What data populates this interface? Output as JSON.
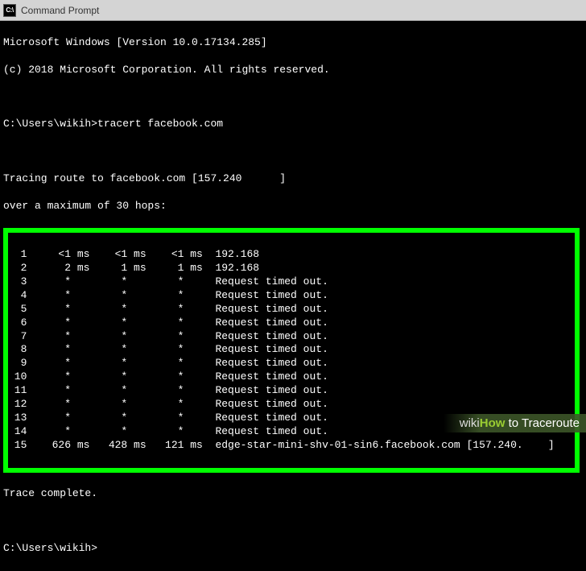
{
  "titlebar": {
    "icon_text": "C:\\",
    "title": "Command Prompt"
  },
  "header": {
    "line1": "Microsoft Windows [Version 10.0.17134.285]",
    "line2": "(c) 2018 Microsoft Corporation. All rights reserved."
  },
  "prompt1": "C:\\Users\\wikih>tracert facebook.com",
  "tracing": {
    "line1": "Tracing route to facebook.com [157.240      ]",
    "line2": "over a maximum of 30 hops:"
  },
  "hops": [
    {
      "n": " 1",
      "t1": "   <1 ms",
      "t2": "   <1 ms",
      "t3": "   <1 ms",
      "dest": "192.168"
    },
    {
      "n": " 2",
      "t1": "    2 ms",
      "t2": "    1 ms",
      "t3": "    1 ms",
      "dest": "192.168"
    },
    {
      "n": " 3",
      "t1": "    *   ",
      "t2": "    *   ",
      "t3": "    *   ",
      "dest": "Request timed out."
    },
    {
      "n": " 4",
      "t1": "    *   ",
      "t2": "    *   ",
      "t3": "    *   ",
      "dest": "Request timed out."
    },
    {
      "n": " 5",
      "t1": "    *   ",
      "t2": "    *   ",
      "t3": "    *   ",
      "dest": "Request timed out."
    },
    {
      "n": " 6",
      "t1": "    *   ",
      "t2": "    *   ",
      "t3": "    *   ",
      "dest": "Request timed out."
    },
    {
      "n": " 7",
      "t1": "    *   ",
      "t2": "    *   ",
      "t3": "    *   ",
      "dest": "Request timed out."
    },
    {
      "n": " 8",
      "t1": "    *   ",
      "t2": "    *   ",
      "t3": "    *   ",
      "dest": "Request timed out."
    },
    {
      "n": " 9",
      "t1": "    *   ",
      "t2": "    *   ",
      "t3": "    *   ",
      "dest": "Request timed out."
    },
    {
      "n": "10",
      "t1": "    *   ",
      "t2": "    *   ",
      "t3": "    *   ",
      "dest": "Request timed out."
    },
    {
      "n": "11",
      "t1": "    *   ",
      "t2": "    *   ",
      "t3": "    *   ",
      "dest": "Request timed out."
    },
    {
      "n": "12",
      "t1": "    *   ",
      "t2": "    *   ",
      "t3": "    *   ",
      "dest": "Request timed out."
    },
    {
      "n": "13",
      "t1": "    *   ",
      "t2": "    *   ",
      "t3": "    *   ",
      "dest": "Request timed out."
    },
    {
      "n": "14",
      "t1": "    *   ",
      "t2": "    *   ",
      "t3": "    *   ",
      "dest": "Request timed out."
    },
    {
      "n": "15",
      "t1": "  626 ms",
      "t2": "  428 ms",
      "t3": "  121 ms",
      "dest": "edge-star-mini-shv-01-sin6.facebook.com [157.240.    ]"
    }
  ],
  "complete": "Trace complete.",
  "prompt2": "C:\\Users\\wikih>",
  "watermark": {
    "wiki": "wiki",
    "how": "How",
    "rest": " to Traceroute"
  }
}
